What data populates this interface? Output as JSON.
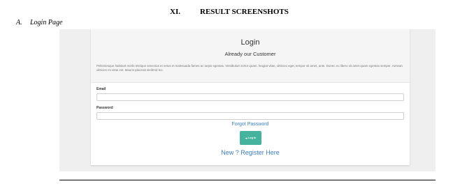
{
  "section": {
    "number": "XI.",
    "title": "RESULT SCREENSHOTS"
  },
  "subsection": {
    "letter": "A.",
    "title": "Login Page"
  },
  "screenshot": {
    "title": "Login",
    "subtitle": "Already our Customer",
    "lorem": "Pellentesque habitant morbi tristique senectus et netus et malesuada fames ac turpis egestas. Vestibulum tortor quam, feugiat vitae, ultricies eget, tempor sit amet, ante. Donec eu libero sit amet quam egestas semper. Aenean ultricies mi vitae est. Mauris placerat eleifend leo.",
    "email_label": "Email",
    "email_value": "",
    "password_label": "Password",
    "password_value": "",
    "forgot_link": "Forgot Password",
    "login_button": "Log In",
    "login_icon": "sign-in-icon",
    "register_link": "New ? Register Here",
    "colors": {
      "button": "#45b39d",
      "link": "#3a7fc1",
      "background": "#efefef"
    }
  }
}
